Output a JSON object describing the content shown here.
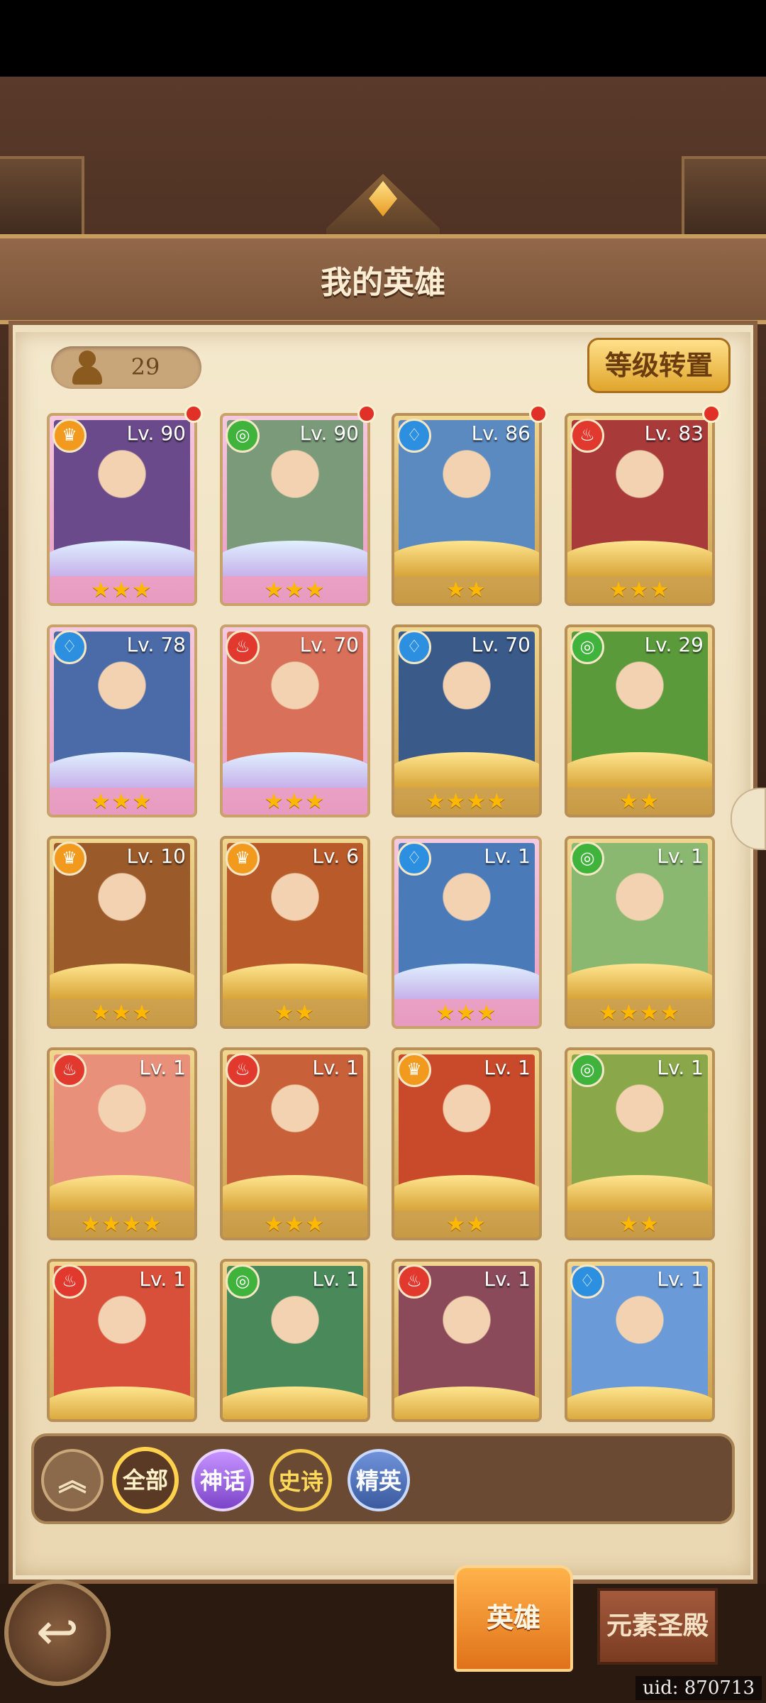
{
  "header": {
    "title": "我的英雄"
  },
  "toolbar": {
    "hero_count": "29",
    "level_transfer_label": "等级转置"
  },
  "elements": {
    "fire": {
      "icon": "flame-icon",
      "color": "#e2392f",
      "glyph": "♨"
    },
    "earth": {
      "icon": "crown-icon",
      "color": "#f29a1e",
      "glyph": "♛"
    },
    "nature": {
      "icon": "swirl-icon",
      "color": "#3fb33c",
      "glyph": "◎"
    },
    "water": {
      "icon": "drop-icon",
      "color": "#2d8fe0",
      "glyph": "♢"
    }
  },
  "heroes": [
    {
      "level": "Lv. 90",
      "element": "earth",
      "stars": 3,
      "pink": true,
      "notify": true,
      "art": "#6a4a8a"
    },
    {
      "level": "Lv. 90",
      "element": "nature",
      "stars": 3,
      "pink": true,
      "notify": true,
      "art": "#7a9a7a"
    },
    {
      "level": "Lv. 86",
      "element": "water",
      "stars": 2,
      "pink": false,
      "notify": true,
      "art": "#5a8ac0"
    },
    {
      "level": "Lv. 83",
      "element": "fire",
      "stars": 3,
      "pink": false,
      "notify": true,
      "art": "#a83a3a"
    },
    {
      "level": "Lv. 78",
      "element": "water",
      "stars": 3,
      "pink": true,
      "notify": false,
      "art": "#4a6aa8"
    },
    {
      "level": "Lv. 70",
      "element": "fire",
      "stars": 3,
      "pink": true,
      "notify": false,
      "art": "#d8705a"
    },
    {
      "level": "Lv. 70",
      "element": "water",
      "stars": 4,
      "pink": false,
      "notify": false,
      "art": "#3a5a8a"
    },
    {
      "level": "Lv. 29",
      "element": "nature",
      "stars": 2,
      "pink": false,
      "notify": false,
      "art": "#5a9a3a"
    },
    {
      "level": "Lv. 10",
      "element": "earth",
      "stars": 3,
      "pink": false,
      "notify": false,
      "art": "#9a5a2a"
    },
    {
      "level": "Lv. 6",
      "element": "earth",
      "stars": 2,
      "pink": false,
      "notify": false,
      "art": "#b85a2a"
    },
    {
      "level": "Lv. 1",
      "element": "water",
      "stars": 3,
      "pink": true,
      "notify": false,
      "art": "#4a7ab8"
    },
    {
      "level": "Lv. 1",
      "element": "nature",
      "stars": 4,
      "pink": false,
      "notify": false,
      "art": "#8ab870"
    },
    {
      "level": "Lv. 1",
      "element": "fire",
      "stars": 4,
      "pink": false,
      "notify": false,
      "art": "#e8907a"
    },
    {
      "level": "Lv. 1",
      "element": "fire",
      "stars": 3,
      "pink": false,
      "notify": false,
      "art": "#c8603a"
    },
    {
      "level": "Lv. 1",
      "element": "earth",
      "stars": 2,
      "pink": false,
      "notify": false,
      "art": "#c84a2a"
    },
    {
      "level": "Lv. 1",
      "element": "nature",
      "stars": 2,
      "pink": false,
      "notify": false,
      "art": "#8aa84a"
    },
    {
      "level": "Lv. 1",
      "element": "fire",
      "stars": 0,
      "pink": false,
      "notify": false,
      "art": "#d8503a"
    },
    {
      "level": "Lv. 1",
      "element": "nature",
      "stars": 0,
      "pink": false,
      "notify": false,
      "art": "#4a8a5a"
    },
    {
      "level": "Lv. 1",
      "element": "fire",
      "stars": 0,
      "pink": false,
      "notify": false,
      "art": "#8a4a5a"
    },
    {
      "level": "Lv. 1",
      "element": "water",
      "stars": 0,
      "pink": false,
      "notify": false,
      "art": "#6a9ad8"
    }
  ],
  "filters": {
    "all_label": "全部",
    "myth_label": "神话",
    "epic_label": "史诗",
    "elite_label": "精英"
  },
  "bottom_nav": {
    "back_label": "↩",
    "hero_tab_label": "英雄",
    "temple_tab_label": "元素圣殿"
  },
  "footer": {
    "uid": "uid: 870713"
  }
}
